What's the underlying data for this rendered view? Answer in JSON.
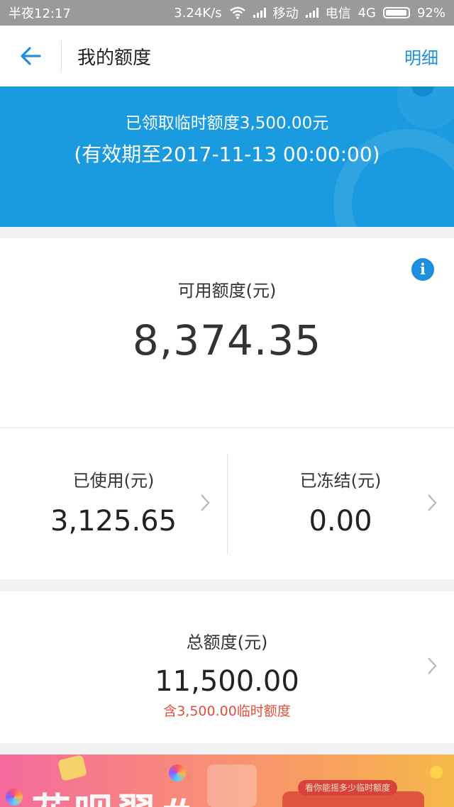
{
  "status_bar": {
    "time": "半夜12:17",
    "speed": "3.24K/s",
    "carrier1": "移动",
    "carrier2": "电信",
    "network": "4G",
    "battery": "92%"
  },
  "nav": {
    "title": "我的额度",
    "right_link": "明细"
  },
  "banner": {
    "line1": "已领取临时额度3,500.00元",
    "line2": "(有效期至2017-11-13 00:00:00)"
  },
  "available": {
    "label": "可用额度(元)",
    "amount": "8,374.35",
    "info_icon": "i"
  },
  "used": {
    "label": "已使用(元)",
    "value": "3,125.65"
  },
  "frozen": {
    "label": "已冻结(元)",
    "value": "0.00"
  },
  "total": {
    "label": "总额度(元)",
    "value": "11,500.00",
    "note": "含3,500.00临时额度"
  },
  "promo": {
    "headline": "花呗翠#",
    "tag": "看你能摇多少临时额度"
  },
  "colors": {
    "accent": "#1e8fdc",
    "banner": "#1a9be0",
    "alert": "#e64c3c"
  }
}
